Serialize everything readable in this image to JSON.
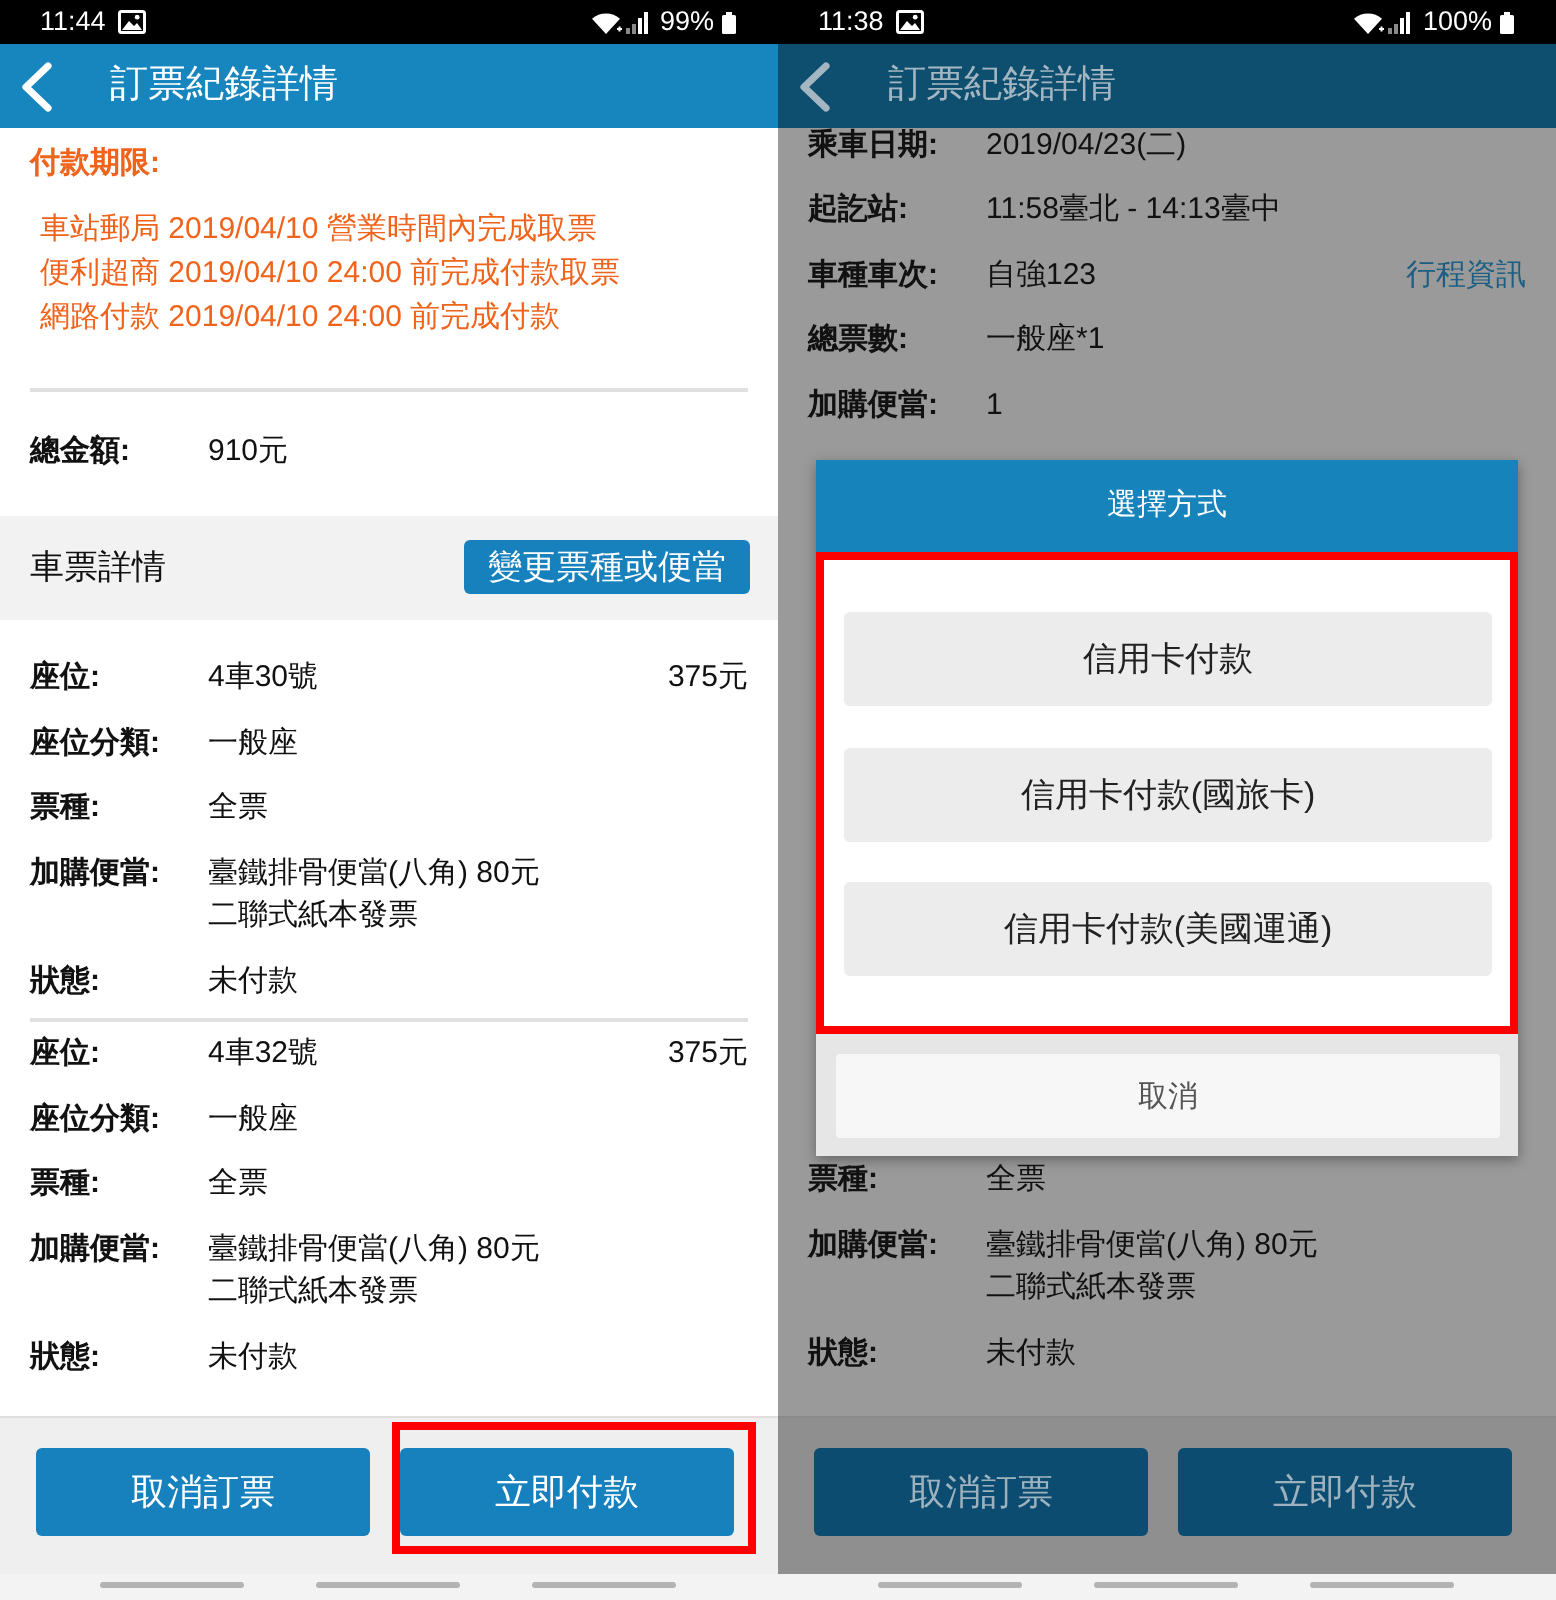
{
  "screens": [
    {
      "status_bar": {
        "time": "11:44",
        "battery": "99%"
      },
      "app_bar": {
        "title": "訂票紀錄詳情"
      },
      "payment_deadline": {
        "title": "付款期限:",
        "lines": [
          "車站郵局 2019/04/10 營業時間內完成取票",
          "便利超商 2019/04/10 24:00 前完成付款取票",
          "網路付款 2019/04/10 24:00 前完成付款"
        ]
      },
      "total": {
        "label": "總金額:",
        "values": [
          "910元"
        ]
      },
      "ticket_section": {
        "title": "車票詳情",
        "button": "變更票種或便當"
      },
      "tickets": [
        {
          "rows": [
            {
              "label": "座位:",
              "values": [
                "4車30號"
              ],
              "price": "375元"
            },
            {
              "label": "座位分類:",
              "values": [
                "一般座"
              ]
            },
            {
              "label": "票種:",
              "values": [
                "全票"
              ]
            },
            {
              "label": "加購便當:",
              "values": [
                "臺鐵排骨便當(八角) 80元",
                "二聯式紙本發票"
              ]
            },
            {
              "label": "狀態:",
              "values": [
                "未付款"
              ]
            }
          ]
        },
        {
          "rows": [
            {
              "label": "座位:",
              "values": [
                "4車32號"
              ],
              "price": "375元"
            },
            {
              "label": "座位分類:",
              "values": [
                "一般座"
              ]
            },
            {
              "label": "票種:",
              "values": [
                "全票"
              ]
            },
            {
              "label": "加購便當:",
              "values": [
                "臺鐵排骨便當(八角) 80元",
                "二聯式紙本發票"
              ]
            },
            {
              "label": "狀態:",
              "values": [
                "未付款"
              ]
            }
          ]
        }
      ],
      "actions": [
        {
          "label": "取消訂票",
          "highlighted": false
        },
        {
          "label": "立即付款",
          "highlighted": true
        }
      ]
    },
    {
      "status_bar": {
        "time": "11:38",
        "battery": "100%"
      },
      "app_bar": {
        "title": "訂票紀錄詳情"
      },
      "details": [
        {
          "label": "乘車日期:",
          "values": [
            "2019/04/23(二)"
          ]
        },
        {
          "label": "起訖站:",
          "values": [
            "11:58臺北 - 14:13臺中"
          ]
        },
        {
          "label": "車種車次:",
          "values": [
            "自強123"
          ],
          "link": "行程資訊"
        },
        {
          "label": "總票數:",
          "values": [
            "一般座*1"
          ]
        },
        {
          "label": "加購便當:",
          "values": [
            "1"
          ]
        }
      ],
      "dialog": {
        "title": "選擇方式",
        "options": [
          "信用卡付款",
          "信用卡付款(國旅卡)",
          "信用卡付款(美國運通)"
        ],
        "options_highlighted": true,
        "cancel": "取消"
      },
      "tickets": [
        {
          "rows": [
            {
              "label": "票種:",
              "values": [
                "全票"
              ]
            },
            {
              "label": "加購便當:",
              "values": [
                "臺鐵排骨便當(八角) 80元",
                "二聯式紙本發票"
              ]
            },
            {
              "label": "狀態:",
              "values": [
                "未付款"
              ]
            }
          ]
        }
      ],
      "actions": [
        {
          "label": "取消訂票",
          "highlighted": false
        },
        {
          "label": "立即付款",
          "highlighted": false
        }
      ]
    }
  ]
}
